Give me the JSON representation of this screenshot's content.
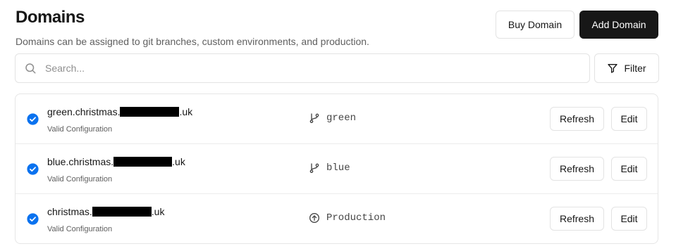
{
  "header": {
    "title": "Domains",
    "subtitle": "Domains can be assigned to git branches, custom environments, and production."
  },
  "actions": {
    "buy_label": "Buy Domain",
    "add_label": "Add Domain"
  },
  "search": {
    "placeholder": "Search...",
    "value": ""
  },
  "filter": {
    "label": "Filter"
  },
  "domains": [
    {
      "prefix": "green.christmas.",
      "suffix": ".uk",
      "status": "Valid Configuration",
      "branch": "green",
      "branch_icon": "git-branch-icon",
      "status_icon": "check-circle-icon"
    },
    {
      "prefix": "blue.christmas.",
      "suffix": ".uk",
      "status": "Valid Configuration",
      "branch": "blue",
      "branch_icon": "git-branch-icon",
      "status_icon": "check-circle-icon"
    },
    {
      "prefix": "christmas.",
      "suffix": ".uk",
      "status": "Valid Configuration",
      "branch": "Production",
      "branch_icon": "production-arrow-up-icon",
      "status_icon": "check-circle-icon"
    }
  ],
  "row_actions": {
    "refresh_label": "Refresh",
    "edit_label": "Edit"
  },
  "colors": {
    "accent_blue": "#0a72ef",
    "dark_button": "#171717",
    "border": "#e3e3e3"
  }
}
